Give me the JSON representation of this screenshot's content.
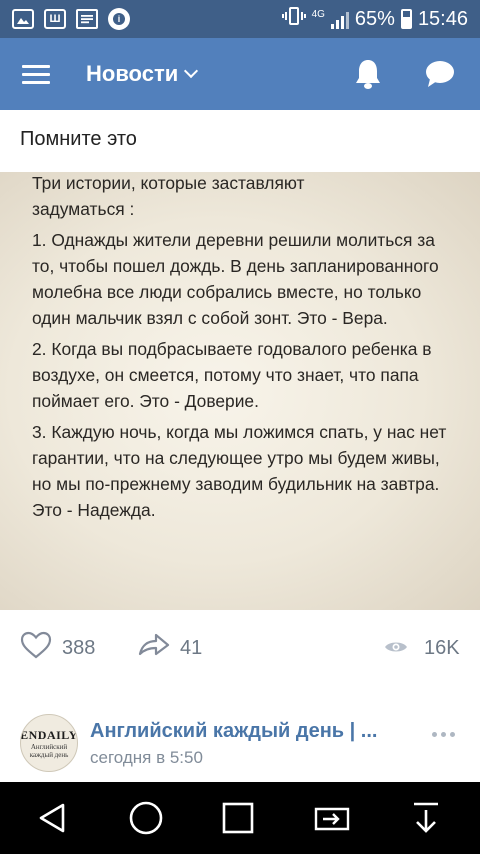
{
  "status_bar": {
    "battery_percent": "65%",
    "time": "15:46",
    "network": "4G",
    "battery_level": 0.65,
    "left_icons": [
      "gallery-icon",
      "w-app-icon",
      "message-icon",
      "notification-badge-icon"
    ]
  },
  "app_bar": {
    "title": "Новости",
    "colors": {
      "background": "#5280bc",
      "status_bar": "#3f5f88"
    }
  },
  "post": {
    "text": "Помните это",
    "image_text": {
      "heading": "Три истории, которые заставляют задуматься :",
      "item1": "1. Однажды жители деревни решили молиться за то, чтобы пошел дождь. В день запланированного молебна все люди собрались вместе, но только один мальчик взял с собой зонт. Это - Вера.",
      "item2": "2. Когда вы подбрасываете годовалого ребенка в воздухе, он смеется, потому что знает, что папа поймает его. Это - Доверие.",
      "item3": "3. Каждую ночь, когда мы ложимся спать, у нас нет гарантии, что на следующее утро мы будем живы, но мы по-прежнему заводим будильник на завтра. Это - Надежда."
    },
    "likes": "388",
    "shares": "41",
    "views": "16K"
  },
  "next_post": {
    "author": "Английский каждый день | ...",
    "time": "сегодня в 5:50",
    "avatar_line1": "ENDAILY",
    "avatar_line2": "Английский каждый день"
  },
  "nav_bar": {
    "buttons": [
      "back-icon",
      "home-icon",
      "recents-icon",
      "screen-mirror-icon",
      "download-icon"
    ]
  }
}
